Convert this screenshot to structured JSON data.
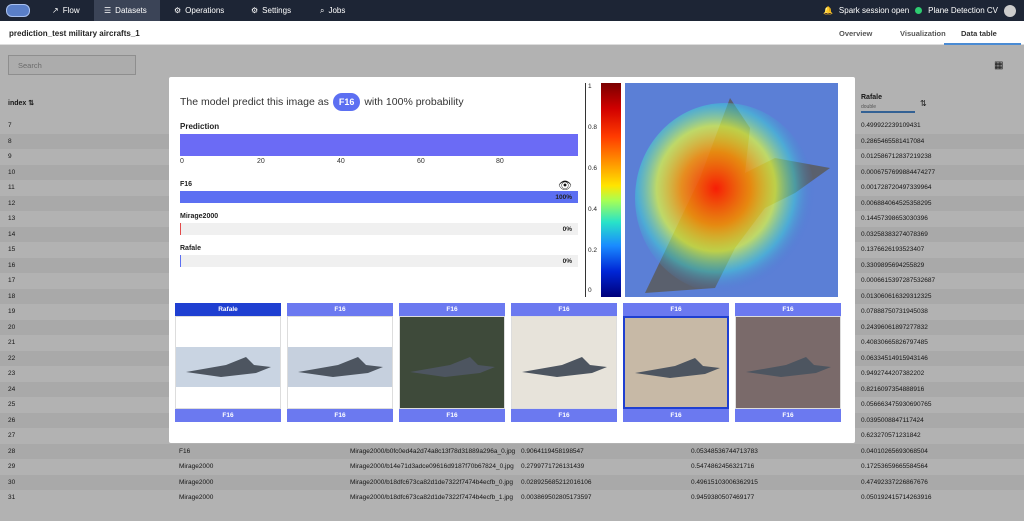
{
  "topnav": {
    "items": [
      {
        "icon": "chart-icon",
        "glyph": "↗",
        "label": "Flow"
      },
      {
        "icon": "list-icon",
        "glyph": "☰",
        "label": "Datasets"
      },
      {
        "icon": "gear-icon",
        "glyph": "⚙",
        "label": "Operations"
      },
      {
        "icon": "gear-icon",
        "glyph": "⚙",
        "label": "Settings"
      },
      {
        "icon": "search-icon",
        "glyph": "⌕",
        "label": "Jobs"
      }
    ],
    "session_status": "Spark session open",
    "project": "Plane Detection CV"
  },
  "page": {
    "title": "prediction_test military aircrafts_1",
    "tabs": [
      "Overview",
      "Visualization",
      "Data table"
    ],
    "active_tab": "Data table",
    "search_placeholder": "Search"
  },
  "table": {
    "col_index": "index",
    "col_rafale": "Rafale",
    "col_rafale_type": "double",
    "rows": [
      {
        "i": "7",
        "c": "",
        "p": "",
        "a": "",
        "b": "",
        "r": "0.499922239109431"
      },
      {
        "i": "8",
        "c": "",
        "p": "",
        "a": "",
        "b": "",
        "r": "0.2865465581417084"
      },
      {
        "i": "9",
        "c": "",
        "p": "",
        "a": "",
        "b": "",
        "r": "0.012586712837219238"
      },
      {
        "i": "10",
        "c": "",
        "p": "",
        "a": "",
        "b": "",
        "r": "0.0006757699884474277"
      },
      {
        "i": "11",
        "c": "",
        "p": "",
        "a": "",
        "b": "",
        "r": "0.001728720497339964"
      },
      {
        "i": "12",
        "c": "",
        "p": "",
        "a": "",
        "b": "",
        "r": "0.006884064525358295"
      },
      {
        "i": "13",
        "c": "",
        "p": "",
        "a": "",
        "b": "",
        "r": "0.14457398653030396"
      },
      {
        "i": "14",
        "c": "",
        "p": "",
        "a": "",
        "b": "",
        "r": "0.03258383274078369"
      },
      {
        "i": "15",
        "c": "",
        "p": "",
        "a": "",
        "b": "",
        "r": "0.1376626193523407"
      },
      {
        "i": "16",
        "c": "",
        "p": "",
        "a": "",
        "b": "",
        "r": "0.3309895694255829"
      },
      {
        "i": "17",
        "c": "",
        "p": "",
        "a": "",
        "b": "",
        "r": "0.0006615397287532687"
      },
      {
        "i": "18",
        "c": "",
        "p": "",
        "a": "",
        "b": "",
        "r": "0.013060616329312325"
      },
      {
        "i": "19",
        "c": "",
        "p": "",
        "a": "",
        "b": "",
        "r": "0.07888750731945038"
      },
      {
        "i": "20",
        "c": "",
        "p": "",
        "a": "",
        "b": "",
        "r": "0.24396061897277832"
      },
      {
        "i": "21",
        "c": "",
        "p": "",
        "a": "",
        "b": "",
        "r": "0.40830665826797485"
      },
      {
        "i": "22",
        "c": "",
        "p": "",
        "a": "",
        "b": "",
        "r": "0.06334514915943146"
      },
      {
        "i": "23",
        "c": "",
        "p": "",
        "a": "",
        "b": "",
        "r": "0.9492744207382202"
      },
      {
        "i": "24",
        "c": "",
        "p": "",
        "a": "",
        "b": "",
        "r": "0.8216097354888916"
      },
      {
        "i": "25",
        "c": "",
        "p": "",
        "a": "",
        "b": "",
        "r": "0.056663475930690765"
      },
      {
        "i": "26",
        "c": "",
        "p": "",
        "a": "",
        "b": "",
        "r": "0.0395008847117424"
      },
      {
        "i": "27",
        "c": "",
        "p": "",
        "a": "",
        "b": "",
        "r": "0.623270571231842"
      },
      {
        "i": "28",
        "c": "F16",
        "p": "Mirage2000/b0fc0ed4a2d74a8c13f78d31889a296a_0.jpg",
        "a": "0.9064119458198547",
        "b": "0.05348536744713783",
        "r": "0.04010265693068504"
      },
      {
        "i": "29",
        "c": "Mirage2000",
        "p": "Mirage2000/b14e71d3adce09616d9187f70b67824_0.jpg",
        "a": "0.2799771726131439",
        "b": "0.5474862456321716",
        "r": "0.17253659665584564"
      },
      {
        "i": "30",
        "c": "Mirage2000",
        "p": "Mirage2000/b18dfc673ca82d1de7322f7474b4ecfb_0.jpg",
        "a": "0.028925685212016106",
        "b": "0.49615103006362915",
        "r": "0.47492337226867676"
      },
      {
        "i": "31",
        "c": "Mirage2000",
        "p": "Mirage2000/b18dfc673ca82d1de7322f7474b4ecfb_1.jpg",
        "a": "0.003869502805173597",
        "b": "0.9459380507469177",
        "r": "0.050192415714263916"
      }
    ]
  },
  "modal": {
    "headline_before": "The model predict this image as",
    "predicted_class": "F16",
    "headline_after": "with 100% probability",
    "prediction_title": "Prediction",
    "prediction_value": 100,
    "axis_ticks": [
      "0",
      "20",
      "40",
      "60",
      "80"
    ],
    "classes": [
      {
        "name": "F16",
        "pct_label": "100%",
        "value": 1.0,
        "color": "#5c6ff2"
      },
      {
        "name": "Mirage2000",
        "pct_label": "0%",
        "value": 0.0,
        "color": "#e34b4b"
      },
      {
        "name": "Rafale",
        "pct_label": "0%",
        "value": 0.0,
        "color": "#5c6ff2"
      }
    ],
    "colorbar_ticks": [
      "1",
      "0.8",
      "0.6",
      "0.4",
      "0.2",
      "0"
    ],
    "thumbnails": [
      {
        "true_label": "Rafale",
        "pred_label": "F16",
        "selected": false
      },
      {
        "true_label": "F16",
        "pred_label": "F16",
        "selected": false
      },
      {
        "true_label": "F16",
        "pred_label": "F16",
        "selected": false
      },
      {
        "true_label": "F16",
        "pred_label": "F16",
        "selected": false
      },
      {
        "true_label": "F16",
        "pred_label": "F16",
        "selected": true
      },
      {
        "true_label": "F16",
        "pred_label": "F16",
        "selected": false
      }
    ]
  }
}
